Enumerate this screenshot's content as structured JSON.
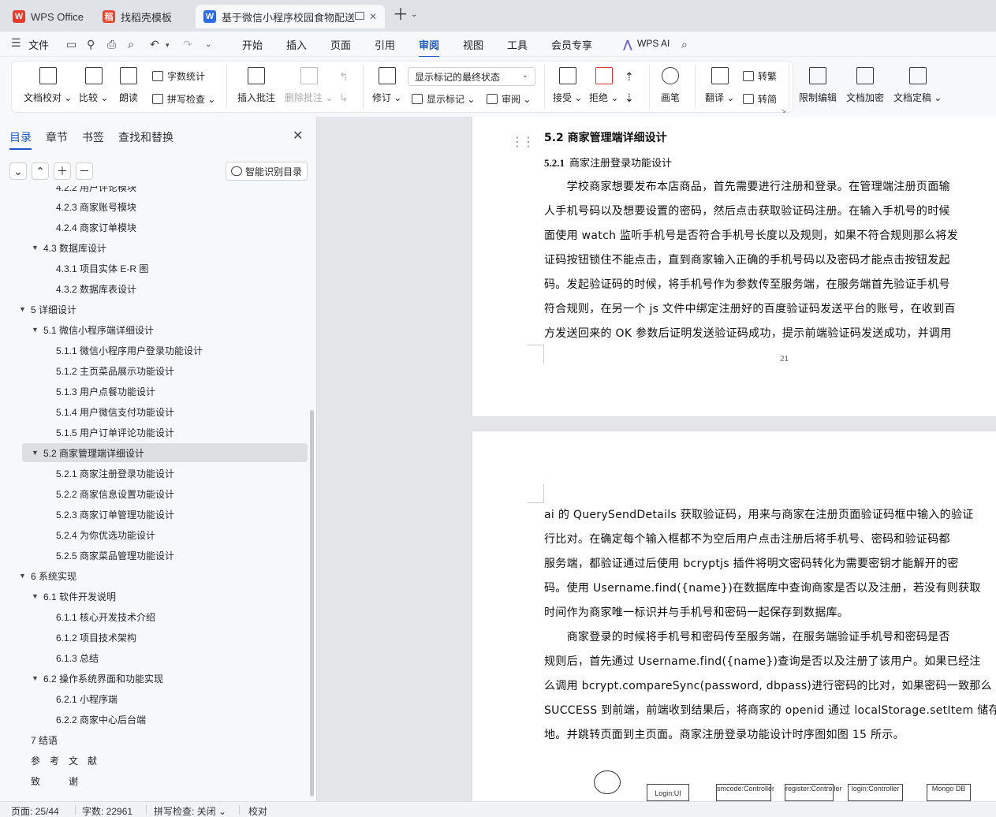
{
  "tabs": [
    {
      "label": "WPS Office"
    },
    {
      "label": "找稻壳模板"
    },
    {
      "label": "基于微信小程序校园食物配送"
    }
  ],
  "menu": {
    "file": "文件",
    "items": [
      "开始",
      "插入",
      "页面",
      "引用",
      "审阅",
      "视图",
      "工具",
      "会员专享"
    ],
    "active": "审阅",
    "wps_ai": "WPS AI"
  },
  "ribbon": {
    "doc_check": "文档校对",
    "compare": "比较",
    "read_aloud": "朗读",
    "word_count": "字数统计",
    "spell_check": "拼写检查",
    "insert_comment": "插入批注",
    "delete_comment": "删除批注",
    "revise": "修订",
    "markup_state": "显示标记的最终状态",
    "show_markup": "显示标记",
    "review": "审阅",
    "accept": "接受",
    "reject": "拒绝",
    "pen": "画笔",
    "translate": "翻译",
    "to_traditional": "转繁",
    "to_simplified": "转简",
    "restrict_edit": "限制编辑",
    "doc_encrypt": "文档加密",
    "doc_finalize": "文档定稿"
  },
  "sidepanel": {
    "tabs": [
      "目录",
      "章节",
      "书签",
      "查找和替换"
    ],
    "smart_toc": "智能识别目录",
    "toc": [
      {
        "label": "4.2.2   用户评论模块"
      },
      {
        "label": "4.2.3   商家账号模块"
      },
      {
        "label": "4.2.4   商家订单模块"
      },
      {
        "label": "4.3   数据库设计"
      },
      {
        "label": "4.3.1   项目实体 E-R 图"
      },
      {
        "label": "4.3.2   数据库表设计"
      },
      {
        "label": "5   详细设计"
      },
      {
        "label": "5.1   微信小程序端详细设计"
      },
      {
        "label": "5.1.1  微信小程序用户登录功能设计"
      },
      {
        "label": "5.1.2  主页菜品展示功能设计"
      },
      {
        "label": "5.1.3  用户点餐功能设计"
      },
      {
        "label": "5.1.4  用户微信支付功能设计"
      },
      {
        "label": "5.1.5  用户订单评论功能设计"
      },
      {
        "label": "5.2   商家管理端详细设计"
      },
      {
        "label": "5.2.1  商家注册登录功能设计"
      },
      {
        "label": "5.2.2  商家信息设置功能设计"
      },
      {
        "label": "5.2.3  商家订单管理功能设计"
      },
      {
        "label": "5.2.4  为你优选功能设计"
      },
      {
        "label": "5.2.5  商家菜品管理功能设计"
      },
      {
        "label": "6   系统实现"
      },
      {
        "label": "6.1   软件开发说明"
      },
      {
        "label": "6.1.1   核心开发技术介绍"
      },
      {
        "label": "6.1.2   项目技术架构"
      },
      {
        "label": "6.1.3   总结"
      },
      {
        "label": "6.2   操作系统界面和功能实现"
      },
      {
        "label": "6.2.1   小程序端"
      },
      {
        "label": "6.2.2   商家中心后台端"
      },
      {
        "label": "7   结语"
      },
      {
        "label": "参　考　文　献"
      },
      {
        "label": "致　　　谢"
      }
    ]
  },
  "document": {
    "heading": "5.2   商家管理端详细设计",
    "subheading_num": "5.2.1",
    "subheading_text": "商家注册登录功能设计",
    "page1_lines": [
      "　　学校商家想要发布本店商品，首先需要进行注册和登录。在管理端注册页面输",
      "人手机号码以及想要设置的密码，然后点击获取验证码注册。在输入手机号的时候",
      "面使用 watch 监听手机号是否符合手机号长度以及规则，如果不符合规则那么将发",
      "证码按钮锁住不能点击，直到商家输入正确的手机号码以及密码才能点击按钮发起",
      "码。发起验证码的时候，将手机号作为参数传至服务端，在服务端首先验证手机号",
      "符合规则，在另一个 js 文件中绑定注册好的百度验证码发送平台的账号，在收到百",
      "方发送回来的 OK 参数后证明发送验证码成功，提示前端验证码发送成功，并调用"
    ],
    "page_number": "21",
    "page2_lines": [
      "ai 的 QuerySendDetails 获取验证码，用来与商家在注册页面验证码框中输入的验证",
      "行比对。在确定每个输入框都不为空后用户点击注册后将手机号、密码和验证码都",
      "服务端，都验证通过后使用 bcryptjs 插件将明文密码转化为需要密钥才能解开的密",
      "码。使用 Username.find({name})在数据库中查询商家是否以及注册，若没有则获取",
      "时间作为商家唯一标识并与手机号和密码一起保存到数据库。",
      "　　商家登录的时候将手机号和密码传至服务端，在服务端验证手机号和密码是否",
      "规则后，首先通过 Username.find({name})查询是否以及注册了该用户。如果已经注",
      "么调用 bcrypt.compareSync(password, dbpass)进行密码的比对，如果密码一致那么",
      "SUCCESS 到前端，前端收到结果后，将商家的 openid 通过 localStorage.setItem 储存",
      "地。并跳转页面到主页面。商家注册登录功能设计时序图如图 15 所示。"
    ],
    "diagram_boxes": [
      "Login:UI",
      "smcode:Controller",
      "register:Controller",
      "login:Controller",
      "Mongo DB"
    ]
  },
  "status": {
    "page": "页面: 25/44",
    "words": "字数: 22961",
    "spell": "拼写检查: 关闭",
    "proof": "校对"
  }
}
